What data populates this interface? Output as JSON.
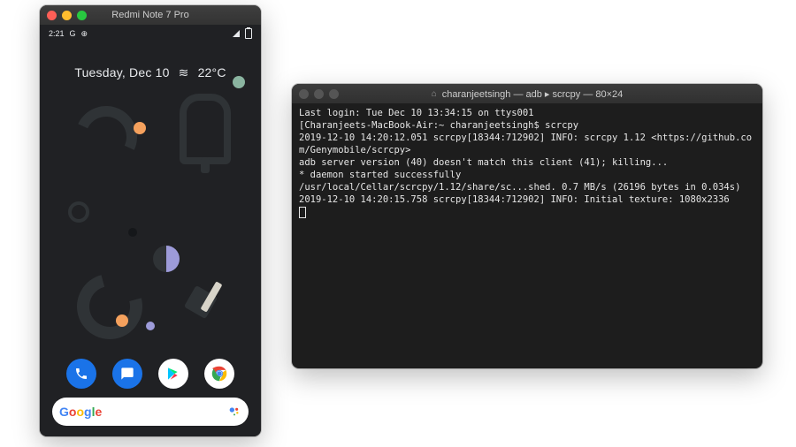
{
  "phone_window": {
    "title": "Redmi Note 7 Pro",
    "status": {
      "time": "2:21",
      "left_icons": [
        "G",
        "⊕"
      ],
      "right_battery": true
    },
    "date_text": "Tuesday, Dec 10",
    "weather_text": "22°C",
    "weather_icon": "≋",
    "dock": [
      {
        "name": "phone",
        "label": "Phone"
      },
      {
        "name": "messages",
        "label": "Messages"
      },
      {
        "name": "play",
        "label": "Play Store"
      },
      {
        "name": "chrome",
        "label": "Chrome"
      }
    ],
    "search": {
      "placeholder": "",
      "logo": "Google",
      "assistant": true
    }
  },
  "terminal_window": {
    "title_icon": "⌂",
    "title": "charanjeetsingh — adb ▸ scrcpy — 80×24",
    "traffic_active": false,
    "lines": [
      "Last login: Tue Dec 10 13:34:15 on ttys001",
      "[Charanjeets-MacBook-Air:~ charanjeetsingh$ scrcpy",
      "2019-12-10 14:20:12.051 scrcpy[18344:712902] INFO: scrcpy 1.12 <https://github.com/Genymobile/scrcpy>",
      "adb server version (40) doesn't match this client (41); killing...",
      "* daemon started successfully",
      "/usr/local/Cellar/scrcpy/1.12/share/sc...shed. 0.7 MB/s (26196 bytes in 0.034s)",
      "2019-12-10 14:20:15.758 scrcpy[18344:712902] INFO: Initial texture: 1080x2336"
    ]
  }
}
